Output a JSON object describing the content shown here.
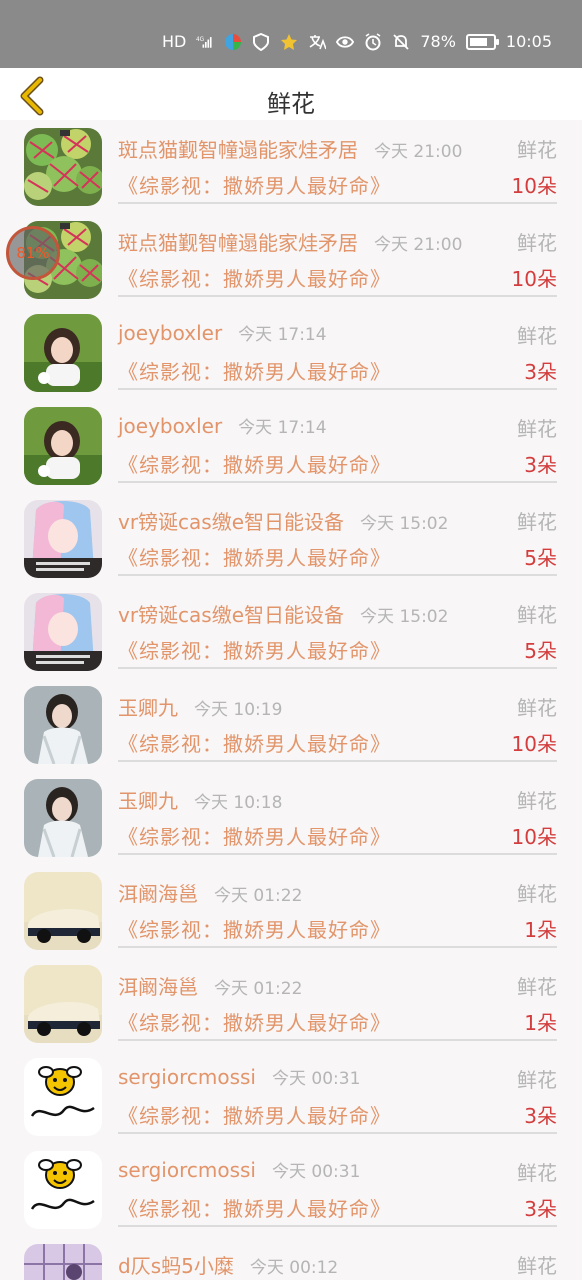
{
  "status_bar": {
    "network": "HD",
    "signal": "4G",
    "battery_text": "78%",
    "battery_level": 0.78,
    "time": "10:05"
  },
  "header": {
    "title": "鲜花",
    "back_icon": "chevron-left-icon",
    "accent_color": "#e8b800"
  },
  "floating_ball": {
    "text": "81%"
  },
  "rows": [
    {
      "name": "斑点猫觐智幢遢能家烓矛居",
      "time": "今天 21:00",
      "type": "鲜花",
      "book": "《综影视：撒娇男人最好命》",
      "count": "10朵",
      "avatar": "cactus"
    },
    {
      "name": "斑点猫觐智幢遢能家烓矛居",
      "time": "今天 21:00",
      "type": "鲜花",
      "book": "《综影视：撒娇男人最好命》",
      "count": "10朵",
      "avatar": "cactus"
    },
    {
      "name": "joeyboxler",
      "time": "今天 17:14",
      "type": "鲜花",
      "book": "《综影视：撒娇男人最好命》",
      "count": "3朵",
      "avatar": "girl-grass"
    },
    {
      "name": "joeyboxler",
      "time": "今天 17:14",
      "type": "鲜花",
      "book": "《综影视：撒娇男人最好命》",
      "count": "3朵",
      "avatar": "girl-grass"
    },
    {
      "name": "vr镑诞cas缴e智日能设备",
      "time": "今天 15:02",
      "type": "鲜花",
      "book": "《综影视：撒娇男人最好命》",
      "count": "5朵",
      "avatar": "anime-girl"
    },
    {
      "name": "vr镑诞cas缴e智日能设备",
      "time": "今天 15:02",
      "type": "鲜花",
      "book": "《综影视：撒娇男人最好命》",
      "count": "5朵",
      "avatar": "anime-girl"
    },
    {
      "name": "玉卿九",
      "time": "今天 10:19",
      "type": "鲜花",
      "book": "《综影视：撒娇男人最好命》",
      "count": "10朵",
      "avatar": "costume-girl"
    },
    {
      "name": "玉卿九",
      "time": "今天 10:18",
      "type": "鲜花",
      "book": "《综影视：撒娇男人最好命》",
      "count": "10朵",
      "avatar": "costume-girl"
    },
    {
      "name": "洱阚海邕",
      "time": "今天 01:22",
      "type": "鲜花",
      "book": "《综影视：撒娇男人最好命》",
      "count": "1朵",
      "avatar": "car"
    },
    {
      "name": "洱阚海邕",
      "time": "今天 01:22",
      "type": "鲜花",
      "book": "《综影视：撒娇男人最好命》",
      "count": "1朵",
      "avatar": "car"
    },
    {
      "name": "sergiorcmossi",
      "time": "今天 00:31",
      "type": "鲜花",
      "book": "《综影视：撒娇男人最好命》",
      "count": "3朵",
      "avatar": "bee"
    },
    {
      "name": "sergiorcmossi",
      "time": "今天 00:31",
      "type": "鲜花",
      "book": "《综影视：撒娇男人最好命》",
      "count": "3朵",
      "avatar": "bee"
    },
    {
      "name": "d仄s蚂5小糜",
      "time": "今天 00:12",
      "type": "鲜花",
      "book": "",
      "count": "",
      "avatar": "grid"
    }
  ]
}
